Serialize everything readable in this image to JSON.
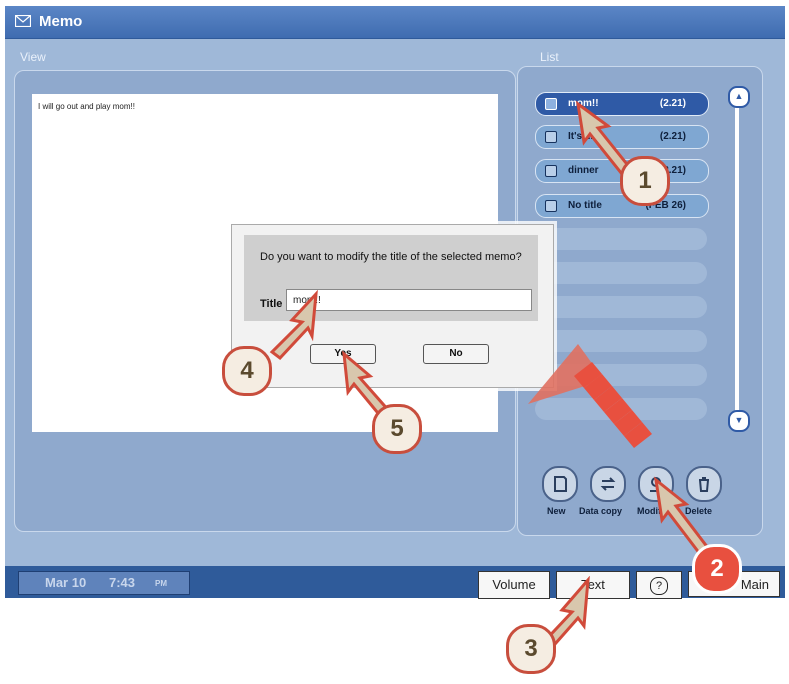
{
  "window": {
    "title": "Memo",
    "title_icon": "envelope-icon"
  },
  "view": {
    "label": "View",
    "content": "I will go out and play mom!!"
  },
  "list": {
    "label": "List",
    "items": [
      {
        "name": "mom!!",
        "date": "(2.21)",
        "selected": true,
        "icon": "memo-icon"
      },
      {
        "name": "It's ... !",
        "date": "(2.21)",
        "selected": false,
        "icon": "memo-icon"
      },
      {
        "name": "dinner",
        "date": "(2.21)",
        "selected": false,
        "icon": "edit-memo-icon"
      },
      {
        "name": "No title",
        "date": "(FEB 26)",
        "selected": false,
        "icon": "memo-icon"
      }
    ],
    "scroll_up_icon": "scroll-up-icon",
    "scroll_down_icon": "scroll-down-icon"
  },
  "actions": [
    {
      "label": "New",
      "icon": "new-memo-icon"
    },
    {
      "label": "Data copy",
      "icon": "data-copy-icon"
    },
    {
      "label": "Modify",
      "icon": "modify-icon"
    },
    {
      "label": "Delete",
      "icon": "trash-icon"
    }
  ],
  "dialog": {
    "question": "Do you want to modify the title of the selected memo?",
    "title_label": "Title",
    "title_value": "mom!!",
    "yes_label": "Yes",
    "no_label": "No"
  },
  "statusbar": {
    "date": "Mar 10",
    "time": "7:43",
    "ampm": "PM",
    "tabs": [
      "Volume",
      "Text",
      "?",
      "Main"
    ]
  },
  "steps": [
    "1",
    "2",
    "3",
    "4",
    "5"
  ],
  "colors": {
    "titlebar": "#3f6cb0",
    "accent_selected": "#2f5aa6",
    "callout_red": "#e8503f"
  }
}
